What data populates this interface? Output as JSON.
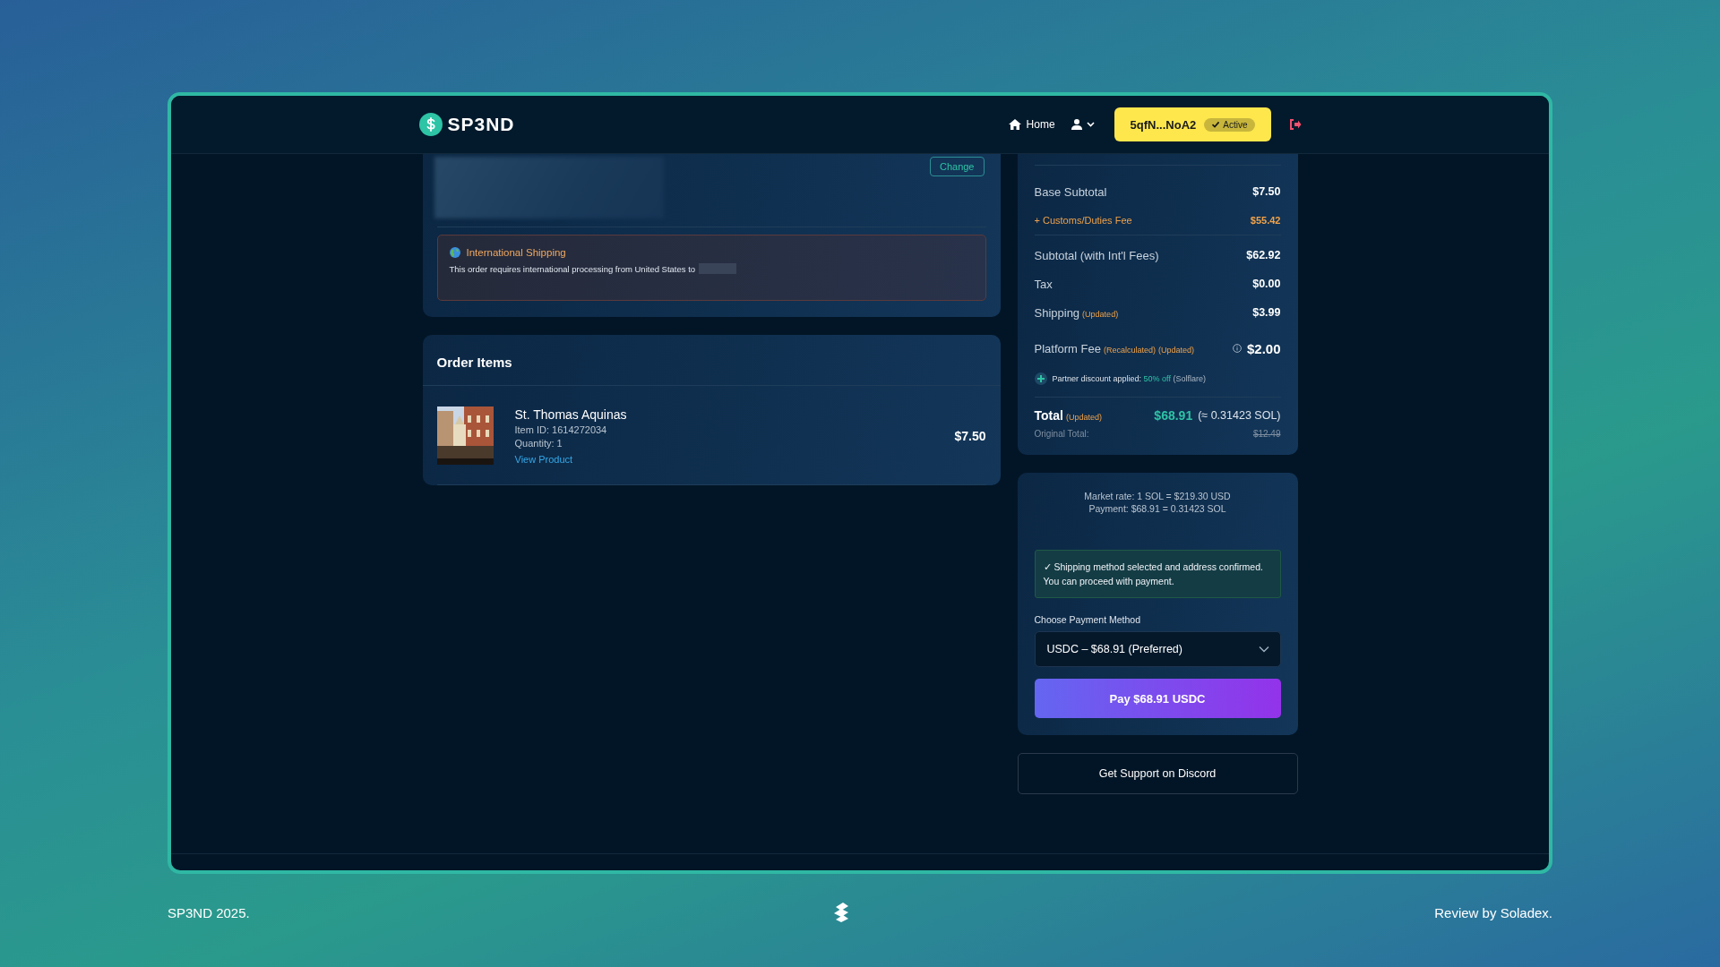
{
  "header": {
    "logo": "SP3ND",
    "nav": [
      {
        "kind": "home",
        "label": "Home"
      },
      {
        "kind": "account"
      }
    ],
    "wallet": {
      "address": "5qfN...NoA2",
      "status": "Active"
    }
  },
  "address_card": {
    "change_button": "Change",
    "notice": {
      "title": "International Shipping",
      "text": "This order requires international processing from United States to"
    }
  },
  "order_items": {
    "title": "Order Items",
    "items": [
      {
        "kind": "picture",
        "name": "St. Thomas Aquinas",
        "item_id": "Item ID: 1614272034",
        "quantity": "Quantity: 1",
        "link": "View Product",
        "price": "$7.50"
      }
    ]
  },
  "summary": {
    "rows": [
      {
        "kind": "plain",
        "label": "Base Subtotal",
        "tags": [],
        "value": "$7.50",
        "divider_after": false
      },
      {
        "kind": "fee",
        "label": "+ Customs/Duties Fee",
        "tags": [],
        "value": "$55.42",
        "divider_after": true
      },
      {
        "kind": "plain",
        "label": "Subtotal (with Int'l Fees)",
        "tags": [],
        "value": "$62.92",
        "divider_after": false
      },
      {
        "kind": "plain",
        "label": "Tax",
        "tags": [],
        "value": "$0.00",
        "divider_after": false
      },
      {
        "kind": "plain",
        "label": "Shipping",
        "tags": [
          "(Updated)"
        ],
        "value": "$3.99",
        "divider_after": false
      },
      {
        "kind": "info",
        "label": "Platform Fee",
        "tags": [
          "(Recalculated)",
          "(Updated)"
        ],
        "value": "$2.00",
        "divider_after": false
      }
    ],
    "partner_note": {
      "prefix": "Partner discount applied:",
      "highlight": "50% off",
      "suffix": "(Solflare)"
    },
    "total": {
      "label": "Total",
      "tag": "(Updated)",
      "amount": "$68.91",
      "sol": "(≈ 0.31423 SOL)",
      "original_label": "Original Total:",
      "original_value": "$12.49"
    }
  },
  "payment": {
    "rate_lines": [
      "Market rate: 1 SOL = $219.30 USD",
      "Payment: $68.91 = 0.31423 SOL"
    ],
    "notice": "✓ Shipping method selected and address confirmed. You can proceed with payment.",
    "method_label": "Choose Payment Method",
    "method_value": "USDC – $68.91 (Preferred)",
    "pay_button": "Pay $68.91 USDC"
  },
  "support_button": "Get Support on Discord",
  "footer": {
    "left": "SP3ND 2025.",
    "right": "Review by Soladex."
  }
}
